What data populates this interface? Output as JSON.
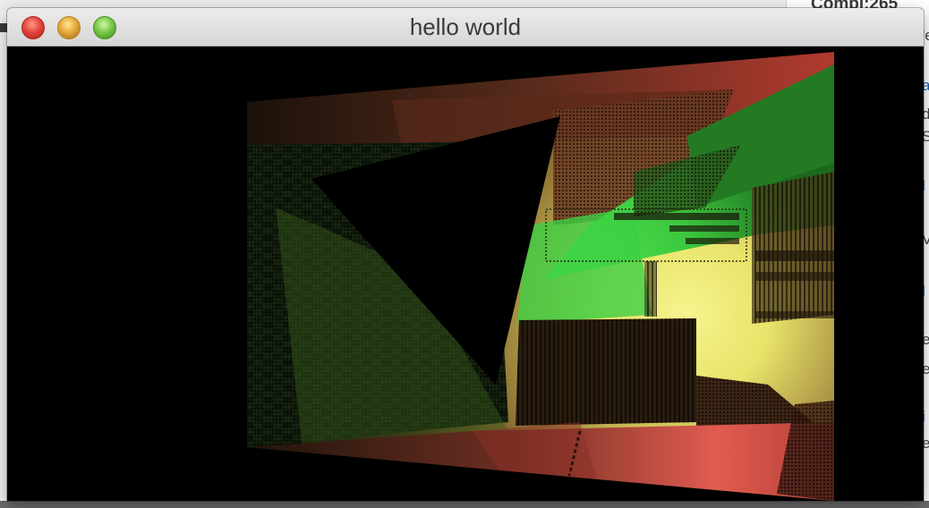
{
  "window": {
    "title": "hello world",
    "controls": [
      "close",
      "minimize",
      "zoom"
    ]
  },
  "background": {
    "title_fragment": "Compl:265",
    "side_fragments": [
      "a",
      "'e",
      "d",
      "S",
      "l",
      "V",
      "l",
      "e",
      "e",
      "i",
      "e"
    ]
  },
  "colors": {
    "accent_red": "#d64a43",
    "accent_green": "#3fd24a",
    "accent_yellow": "#f4ef8e",
    "canvas_bg": "#000000",
    "link_blue": "#1a5fb4"
  }
}
